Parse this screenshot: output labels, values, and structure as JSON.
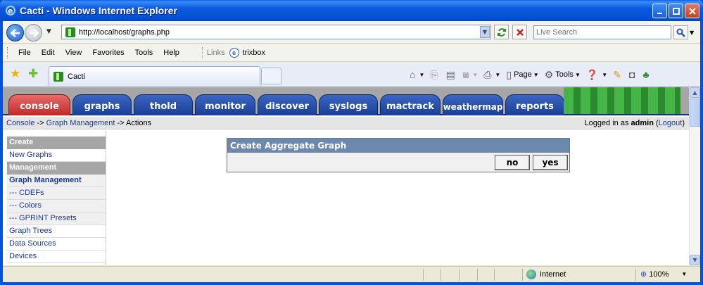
{
  "window": {
    "title": "Cacti - Windows Internet Explorer"
  },
  "addressbar": {
    "url": "http://localhost/graphs.php",
    "search_placeholder": "Live Search"
  },
  "menubar": {
    "items": [
      "File",
      "Edit",
      "View",
      "Favorites",
      "Tools",
      "Help"
    ],
    "links_label": "Links",
    "link_item": "trixbox"
  },
  "tabbar": {
    "tab_title": "Cacti",
    "commands": {
      "page": "Page",
      "tools": "Tools"
    }
  },
  "cacti": {
    "tabs": [
      "console",
      "graphs",
      "thold",
      "monitor",
      "discover",
      "syslogs",
      "mactrack",
      "weathermap",
      "reports"
    ],
    "active_tab": "console",
    "breadcrumb": {
      "console": "Console",
      "sep1": " -> ",
      "graph_mgmt": "Graph Management",
      "sep2": " -> ",
      "current": "Actions"
    },
    "login": {
      "prefix": "Logged in as ",
      "user": "admin",
      "open": " (",
      "logout": "Logout",
      "close": ")"
    },
    "menu": {
      "create_header": "Create",
      "new_graphs": "New Graphs",
      "management_header": "Management",
      "graph_management": "Graph Management",
      "cdefs": "--- CDEFs",
      "colors": "--- Colors",
      "gprint": "--- GPRINT Presets",
      "graph_trees": "Graph Trees",
      "data_sources": "Data Sources",
      "devices": "Devices"
    },
    "dialog": {
      "title": "Create Aggregate Graph",
      "no": "no",
      "yes": "yes"
    }
  },
  "statusbar": {
    "zone": "Internet",
    "zoom": "100%"
  },
  "colors": {
    "tab_blue": "#1a3f94",
    "tab_active": "#c02929",
    "dialog_header": "#6d88ad",
    "link": "#1a3b97"
  }
}
